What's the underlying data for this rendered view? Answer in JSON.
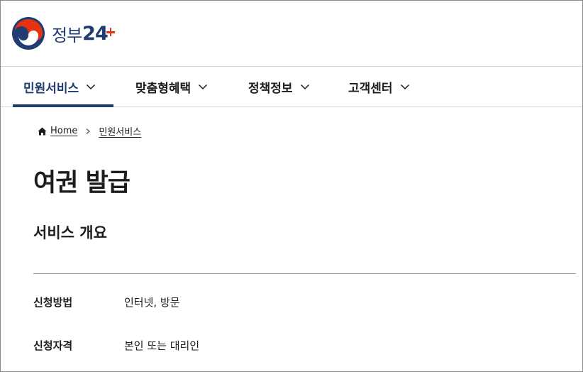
{
  "header": {
    "logo_text": "정부",
    "logo_number": "24"
  },
  "nav": {
    "items": [
      {
        "label": "민원서비스"
      },
      {
        "label": "맞춤형혜택"
      },
      {
        "label": "정책정보"
      },
      {
        "label": "고객센터"
      }
    ]
  },
  "breadcrumb": {
    "home": "Home",
    "current": "민원서비스"
  },
  "page": {
    "title": "여권 발급",
    "section_title": "서비스 개요"
  },
  "overview": {
    "rows": [
      {
        "label": "신청방법",
        "value": "인터넷, 방문"
      },
      {
        "label": "신청자격",
        "value": "본인 또는 대리인"
      }
    ]
  },
  "colors": {
    "brand_navy": "#1f3c73",
    "brand_red": "#e63312"
  }
}
